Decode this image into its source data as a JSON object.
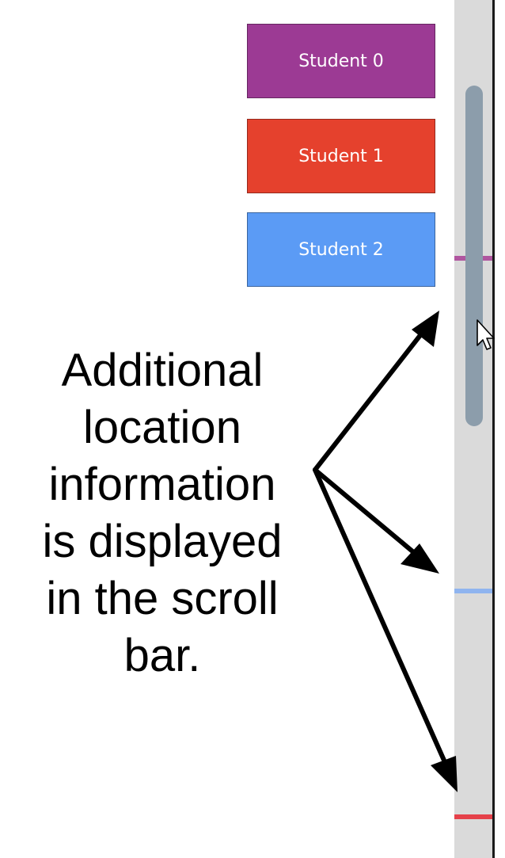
{
  "students": [
    {
      "label": "Student 0",
      "color": "#9c3a94"
    },
    {
      "label": "Student 1",
      "color": "#e5412d"
    },
    {
      "label": "Student 2",
      "color": "#5b9bf5"
    }
  ],
  "scrollbar": {
    "track_color": "#dadada",
    "thumb_color": "#8c9dab",
    "marker_colors": [
      "#b0559f",
      "#e5414a",
      "#8fb4ef"
    ]
  },
  "annotation": {
    "text": "Additional location information is displayed in the scroll bar.",
    "lines": [
      "Additional",
      "location",
      "information",
      "is displayed",
      "in the scroll",
      "bar."
    ],
    "arrow_icon": "arrow-icon"
  },
  "cursor": {
    "icon": "mouse-pointer-icon"
  }
}
